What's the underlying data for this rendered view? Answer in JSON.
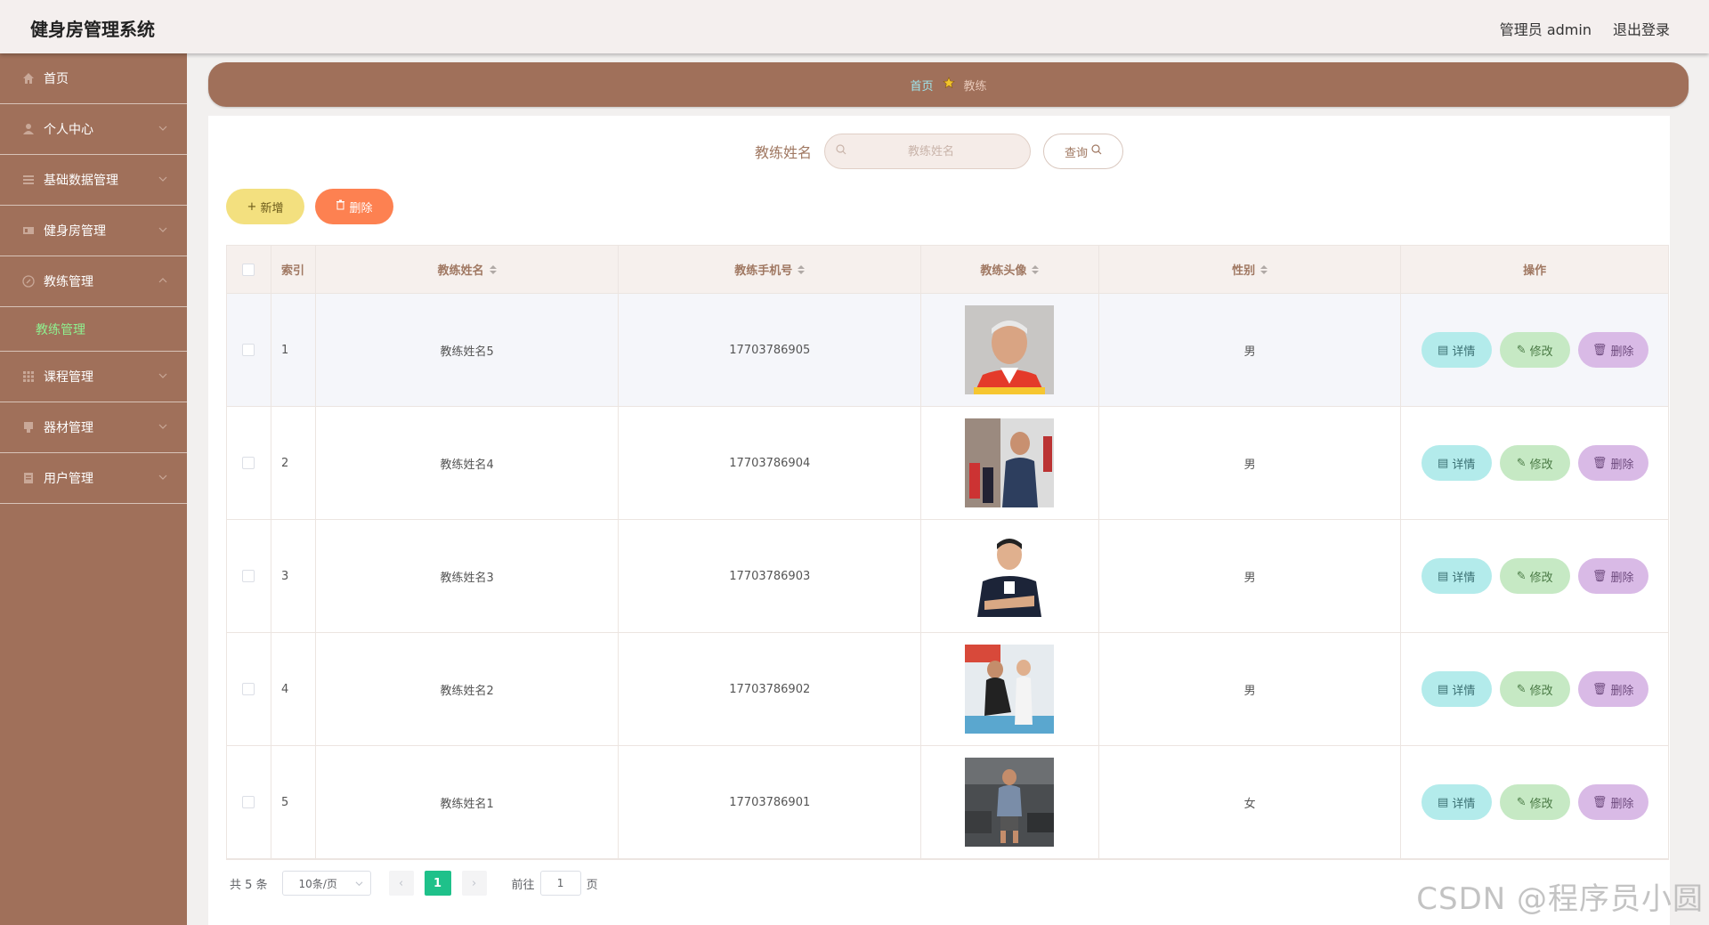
{
  "header": {
    "title": "健身房管理系统",
    "user_label": "管理员 admin",
    "logout_label": "退出登录"
  },
  "sidebar": {
    "items": [
      {
        "label": "首页",
        "icon": "home-icon",
        "has_chevron": false
      },
      {
        "label": "个人中心",
        "icon": "user-icon",
        "has_chevron": true
      },
      {
        "label": "基础数据管理",
        "icon": "menu-icon",
        "has_chevron": true
      },
      {
        "label": "健身房管理",
        "icon": "ticket-icon",
        "has_chevron": true
      },
      {
        "label": "教练管理",
        "icon": "compass-icon",
        "has_chevron": true,
        "expanded": true
      },
      {
        "label": "课程管理",
        "icon": "grid-icon",
        "has_chevron": true
      },
      {
        "label": "器材管理",
        "icon": "box-icon",
        "has_chevron": true
      },
      {
        "label": "用户管理",
        "icon": "doc-icon",
        "has_chevron": true
      }
    ],
    "active_sub": "教练管理"
  },
  "breadcrumb": {
    "home": "首页",
    "current": "教练"
  },
  "search": {
    "label": "教练姓名",
    "placeholder": "教练姓名",
    "query_label": "查询"
  },
  "actions": {
    "add_label": "新增",
    "delete_label": "删除"
  },
  "table": {
    "columns": {
      "index": "索引",
      "name": "教练姓名",
      "phone": "教练手机号",
      "avatar": "教练头像",
      "sex": "性别",
      "ops": "操作"
    },
    "rows": [
      {
        "index": "1",
        "name": "教练姓名5",
        "phone": "17703786905",
        "sex": "男"
      },
      {
        "index": "2",
        "name": "教练姓名4",
        "phone": "17703786904",
        "sex": "男"
      },
      {
        "index": "3",
        "name": "教练姓名3",
        "phone": "17703786903",
        "sex": "男"
      },
      {
        "index": "4",
        "name": "教练姓名2",
        "phone": "17703786902",
        "sex": "男"
      },
      {
        "index": "5",
        "name": "教练姓名1",
        "phone": "17703786901",
        "sex": "女"
      }
    ],
    "op_labels": {
      "detail": "详情",
      "edit": "修改",
      "delete": "删除"
    }
  },
  "pagination": {
    "total": "共 5 条",
    "page_size": "10条/页",
    "current_page": "1",
    "goto_prefix": "前往",
    "goto_value": "1",
    "goto_suffix": "页"
  },
  "watermark": "CSDN @程序员小圆",
  "colors": {
    "brand": "#a0705a",
    "active_page": "#1fc18a",
    "add": "#f3e07f",
    "delete": "#fd8151"
  }
}
